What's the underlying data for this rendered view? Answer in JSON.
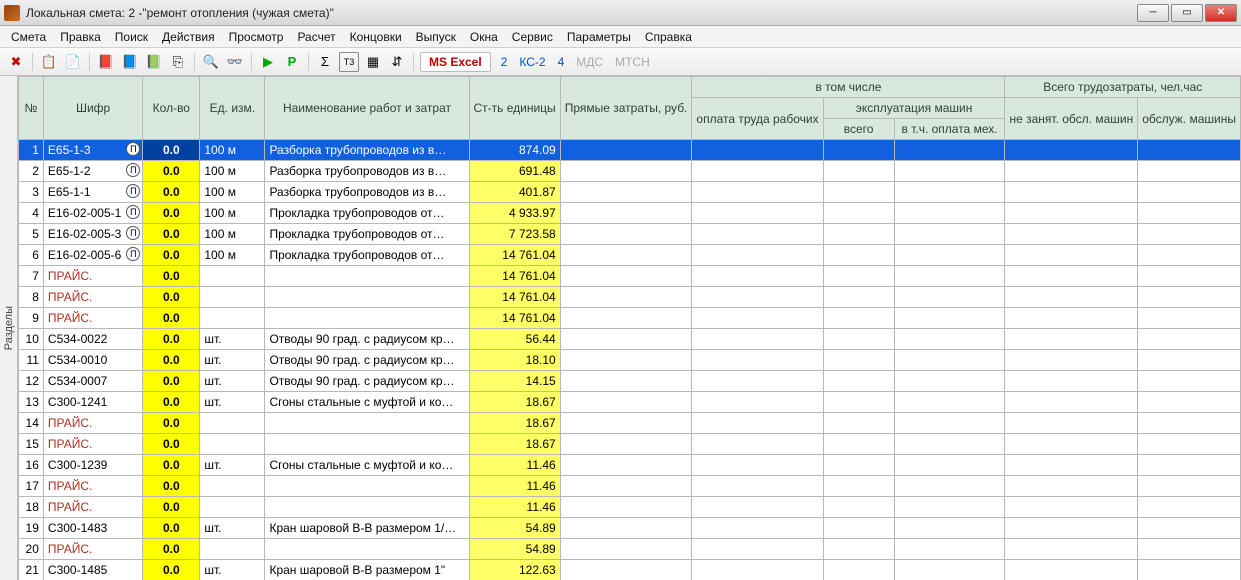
{
  "window": {
    "title": "Локальная смета: 2 -\"ремонт отопления (чужая смета)\""
  },
  "menu": [
    "Смета",
    "Правка",
    "Поиск",
    "Действия",
    "Просмотр",
    "Расчет",
    "Концовки",
    "Выпуск",
    "Окна",
    "Сервис",
    "Параметры",
    "Справка"
  ],
  "toolbar": {
    "excel_label": "MS Excel",
    "links": [
      {
        "label": "2",
        "active": true
      },
      {
        "label": "КС-2",
        "active": true
      },
      {
        "label": "4",
        "active": true
      },
      {
        "label": "МДС",
        "active": false
      },
      {
        "label": "МТСН",
        "active": false
      }
    ]
  },
  "sidebar_tab": "Разделы",
  "headers": {
    "num": "№",
    "cipher": "Шифр",
    "qty": "Кол-во",
    "unit": "Ед. изм.",
    "name": "Наименование работ и затрат",
    "cost": "Ст-ть единицы",
    "direct": "Прямые затраты, руб.",
    "incl": "в том числе",
    "labor": "оплата труда рабочих",
    "equip": "эксплуатация машин",
    "eq_total": "всего",
    "eq_incl": "в т.ч. оплата мех.",
    "tr_total": "Всего трудозатраты, чел.час",
    "tr_mach": "не занят. обсл. машин",
    "tr_serv": "обслуж. машины"
  },
  "rows": [
    {
      "n": 1,
      "cipher": "Е65-1-3",
      "p": true,
      "qty": "0.0",
      "unit": "100 м",
      "name": "Разборка трубопроводов из в…",
      "cost": "874.09",
      "sel": true
    },
    {
      "n": 2,
      "cipher": "Е65-1-2",
      "p": true,
      "qty": "0.0",
      "unit": "100 м",
      "name": "Разборка трубопроводов из в…",
      "cost": "691.48"
    },
    {
      "n": 3,
      "cipher": "Е65-1-1",
      "p": true,
      "qty": "0.0",
      "unit": "100 м",
      "name": "Разборка трубопроводов из в…",
      "cost": "401.87"
    },
    {
      "n": 4,
      "cipher": "Е16-02-005-1",
      "p": true,
      "qty": "0.0",
      "unit": "100 м",
      "name": "Прокладка трубопроводов от…",
      "cost": "4 933.97"
    },
    {
      "n": 5,
      "cipher": "Е16-02-005-3",
      "p": true,
      "qty": "0.0",
      "unit": "100 м",
      "name": "Прокладка трубопроводов от…",
      "cost": "7 723.58"
    },
    {
      "n": 6,
      "cipher": "Е16-02-005-6",
      "p": true,
      "qty": "0.0",
      "unit": "100 м",
      "name": "Прокладка трубопроводов от…",
      "cost": "14 761.04"
    },
    {
      "n": 7,
      "cipher": "ПРАЙС.",
      "red": true,
      "qty": "0.0",
      "unit": "",
      "name": "",
      "cost": "14 761.04"
    },
    {
      "n": 8,
      "cipher": "ПРАЙС.",
      "red": true,
      "qty": "0.0",
      "unit": "",
      "name": "",
      "cost": "14 761.04"
    },
    {
      "n": 9,
      "cipher": "ПРАЙС.",
      "red": true,
      "qty": "0.0",
      "unit": "",
      "name": "",
      "cost": "14 761.04"
    },
    {
      "n": 10,
      "cipher": "С534-0022",
      "qty": "0.0",
      "unit": "шт.",
      "name": "Отводы 90 град. с радиусом кр…",
      "cost": "56.44"
    },
    {
      "n": 11,
      "cipher": "С534-0010",
      "qty": "0.0",
      "unit": "шт.",
      "name": "Отводы 90 град. с радиусом кр…",
      "cost": "18.10"
    },
    {
      "n": 12,
      "cipher": "С534-0007",
      "qty": "0.0",
      "unit": "шт.",
      "name": "Отводы 90 град. с радиусом кр…",
      "cost": "14.15"
    },
    {
      "n": 13,
      "cipher": "С300-1241",
      "qty": "0.0",
      "unit": "шт.",
      "name": "Сгоны стальные с муфтой и ко…",
      "cost": "18.67"
    },
    {
      "n": 14,
      "cipher": "ПРАЙС.",
      "red": true,
      "qty": "0.0",
      "unit": "",
      "name": "",
      "cost": "18.67"
    },
    {
      "n": 15,
      "cipher": "ПРАЙС.",
      "red": true,
      "qty": "0.0",
      "unit": "",
      "name": "",
      "cost": "18.67"
    },
    {
      "n": 16,
      "cipher": "С300-1239",
      "qty": "0.0",
      "unit": "шт.",
      "name": "Сгоны стальные с муфтой и ко…",
      "cost": "11.46"
    },
    {
      "n": 17,
      "cipher": "ПРАЙС.",
      "red": true,
      "qty": "0.0",
      "unit": "",
      "name": "",
      "cost": "11.46"
    },
    {
      "n": 18,
      "cipher": "ПРАЙС.",
      "red": true,
      "qty": "0.0",
      "unit": "",
      "name": "",
      "cost": "11.46"
    },
    {
      "n": 19,
      "cipher": "С300-1483",
      "qty": "0.0",
      "unit": "шт.",
      "name": "Кран шаровой В-В размером 1/…",
      "cost": "54.89"
    },
    {
      "n": 20,
      "cipher": "ПРАЙС.",
      "red": true,
      "qty": "0.0",
      "unit": "",
      "name": "",
      "cost": "54.89"
    },
    {
      "n": 21,
      "cipher": "С300-1485",
      "qty": "0.0",
      "unit": "шт.",
      "name": "Кран шаровой В-В размером 1\"",
      "cost": "122.63"
    }
  ]
}
